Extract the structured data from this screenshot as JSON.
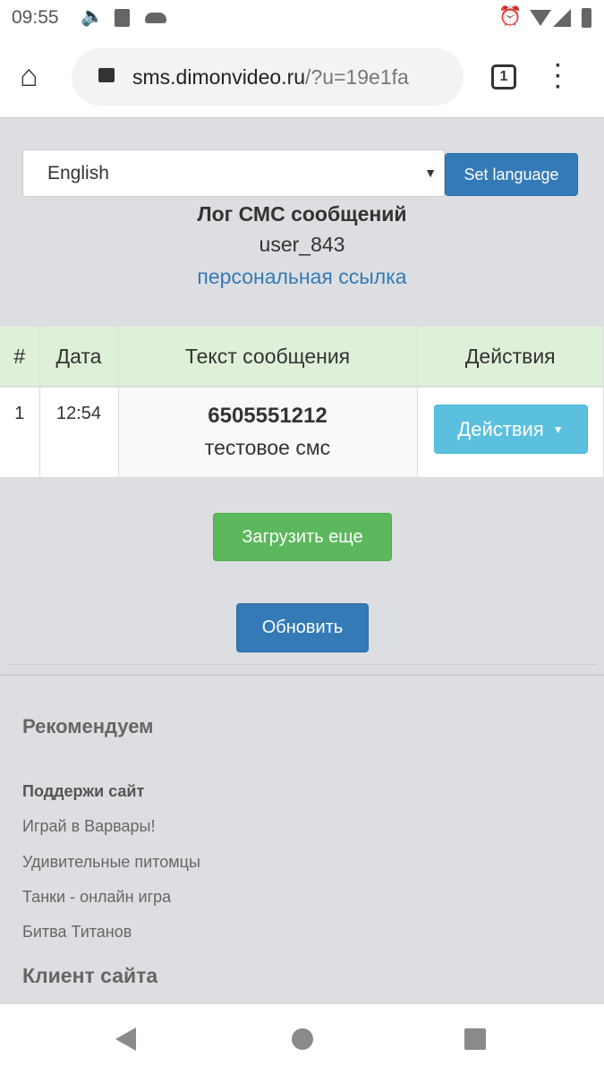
{
  "status_bar": {
    "time": "09:55"
  },
  "browser": {
    "url_host": "sms.dimonvideo.ru",
    "url_rest": "/?u=19e1fa",
    "tab_count": "1"
  },
  "language": {
    "selected": "English",
    "set_label": "Set language"
  },
  "header": {
    "title": "Лог СМС сообщений",
    "user": "user_843",
    "link": "персональная ссылка"
  },
  "table": {
    "headers": [
      "#",
      "Дата",
      "Текст сообщения",
      "Действия"
    ],
    "rows": [
      {
        "num": "1",
        "date": "12:54",
        "phone": "6505551212",
        "text": "тестовое смс",
        "action": "Действия"
      }
    ]
  },
  "buttons": {
    "load_more": "Загрузить еще",
    "refresh": "Обновить"
  },
  "footer": {
    "heading": "Рекомендуем",
    "support": "Поддержи сайт",
    "links": [
      "Играй в Варвары!",
      "Удивительные питомцы",
      "Танки - онлайн игра",
      "Битва Титанов"
    ],
    "client": "Клиент сайта"
  },
  "colors": {
    "primary": "#337ab7",
    "success": "#5cb85c",
    "info": "#5bc0de",
    "header_bg": "#dff0d8",
    "link": "#337ab7"
  }
}
